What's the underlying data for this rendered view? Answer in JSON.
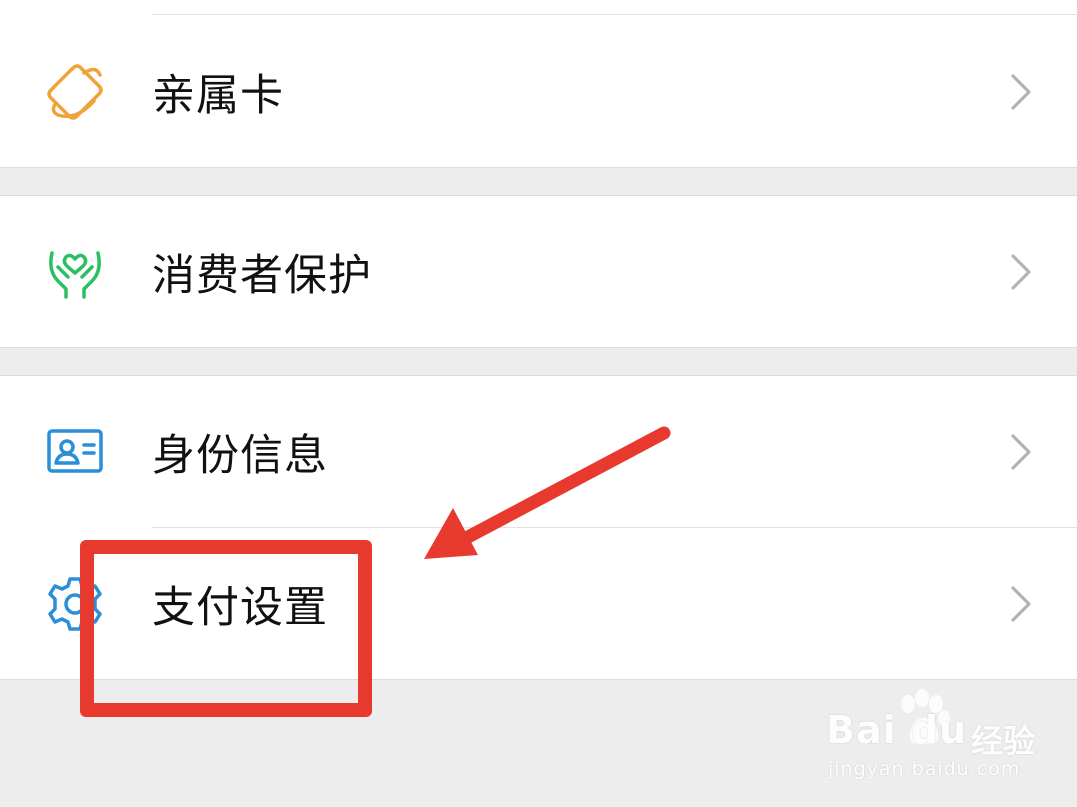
{
  "menu": {
    "items": [
      {
        "label": "亲属卡",
        "icon": "family-card-icon"
      },
      {
        "label": "消费者保护",
        "icon": "consumer-protection-icon"
      },
      {
        "label": "身份信息",
        "icon": "id-card-icon"
      },
      {
        "label": "支付设置",
        "icon": "gear-icon"
      }
    ]
  },
  "colors": {
    "family_card_icon": "#f0a23b",
    "consumer_protection_icon": "#2bbf63",
    "id_card_icon": "#2a8ed8",
    "gear_icon": "#2a8ed8",
    "annotation": "#e8392f",
    "background": "#ededed"
  },
  "watermark": {
    "logo": "Bai du",
    "cn": "经验",
    "url": "jingyan.baidu.com"
  }
}
